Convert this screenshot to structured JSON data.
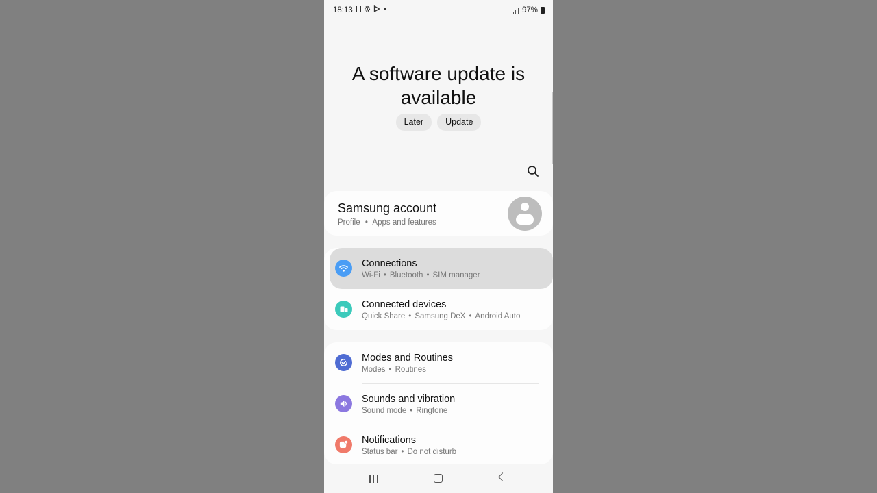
{
  "status_bar": {
    "time": "18:13",
    "battery": "97%",
    "icons": [
      "screenshot-icon",
      "settings-icon",
      "play-store-icon",
      "notification-dot-icon",
      "signal-icon",
      "battery-icon"
    ]
  },
  "update_banner": {
    "title": "A software update is available",
    "later_label": "Later",
    "update_label": "Update"
  },
  "account": {
    "title": "Samsung account",
    "sub_1": "Profile",
    "sub_2": "Apps and features"
  },
  "groups": [
    [
      {
        "title": "Connections",
        "subs": [
          "Wi-Fi",
          "Bluetooth",
          "SIM manager"
        ],
        "icon": "wifi-icon",
        "color": "#4a9df5",
        "highlighted": true
      },
      {
        "title": "Connected devices",
        "subs": [
          "Quick Share",
          "Samsung DeX",
          "Android Auto"
        ],
        "icon": "connected-devices-icon",
        "color": "#3ccabb"
      }
    ],
    [
      {
        "title": "Modes and Routines",
        "subs": [
          "Modes",
          "Routines"
        ],
        "icon": "modes-icon",
        "color": "#4f6cd3"
      },
      {
        "title": "Sounds and vibration",
        "subs": [
          "Sound mode",
          "Ringtone"
        ],
        "icon": "sound-icon",
        "color": "#8c78e0"
      },
      {
        "title": "Notifications",
        "subs": [
          "Status bar",
          "Do not disturb"
        ],
        "icon": "notification-icon",
        "color": "#f07a6a"
      }
    ]
  ],
  "colors": {
    "background": "#808080",
    "screen": "#f6f6f6",
    "card": "#fdfdfd",
    "highlight": "#dcdcdc"
  }
}
